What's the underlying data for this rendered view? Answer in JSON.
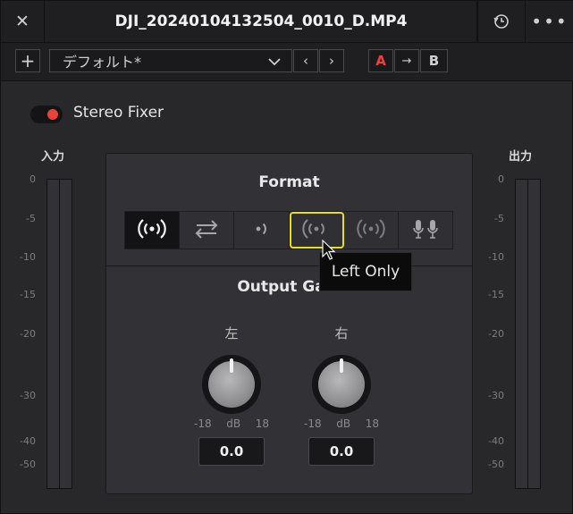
{
  "window": {
    "title": "DJI_20240104132504_0010_D.MP4",
    "close_icon": "close-icon",
    "history_icon": "history-icon",
    "more_icon": "more-horizontal-icon"
  },
  "presets": {
    "add_label": "+",
    "selected": "デフォルト*",
    "prev_label": "‹",
    "next_label": "›",
    "a_label": "A",
    "copy_label": "→",
    "b_label": "B",
    "accent": "#e8433a"
  },
  "plugin": {
    "name": "Stereo Fixer",
    "enabled": true
  },
  "meters": {
    "input_label": "入力",
    "output_label": "出力",
    "scale": [
      "0",
      "-5",
      "-10",
      "-15",
      "-20",
      "-30",
      "-40",
      "-50"
    ]
  },
  "format": {
    "title": "Format",
    "options": [
      {
        "icon": "stereo-icon",
        "name": "Stereo",
        "active": true
      },
      {
        "icon": "swap-icon",
        "name": "Swap",
        "active": false
      },
      {
        "icon": "right-only-icon",
        "name": "Right Only",
        "active": false
      },
      {
        "icon": "left-only-icon",
        "name": "Left Only",
        "active": false
      },
      {
        "icon": "mono-icon",
        "name": "Mono",
        "active": false
      },
      {
        "icon": "dual-mic-icon",
        "name": "Dual Mono",
        "active": false
      }
    ],
    "tooltip": "Left Only",
    "hover_color": "#e7de22"
  },
  "gain": {
    "title": "Output Gain",
    "left": {
      "label": "左",
      "min": "-18",
      "unit": "dB",
      "max": "18",
      "value": "0.0"
    },
    "right": {
      "label": "右",
      "min": "-18",
      "unit": "dB",
      "max": "18",
      "value": "0.0"
    }
  }
}
